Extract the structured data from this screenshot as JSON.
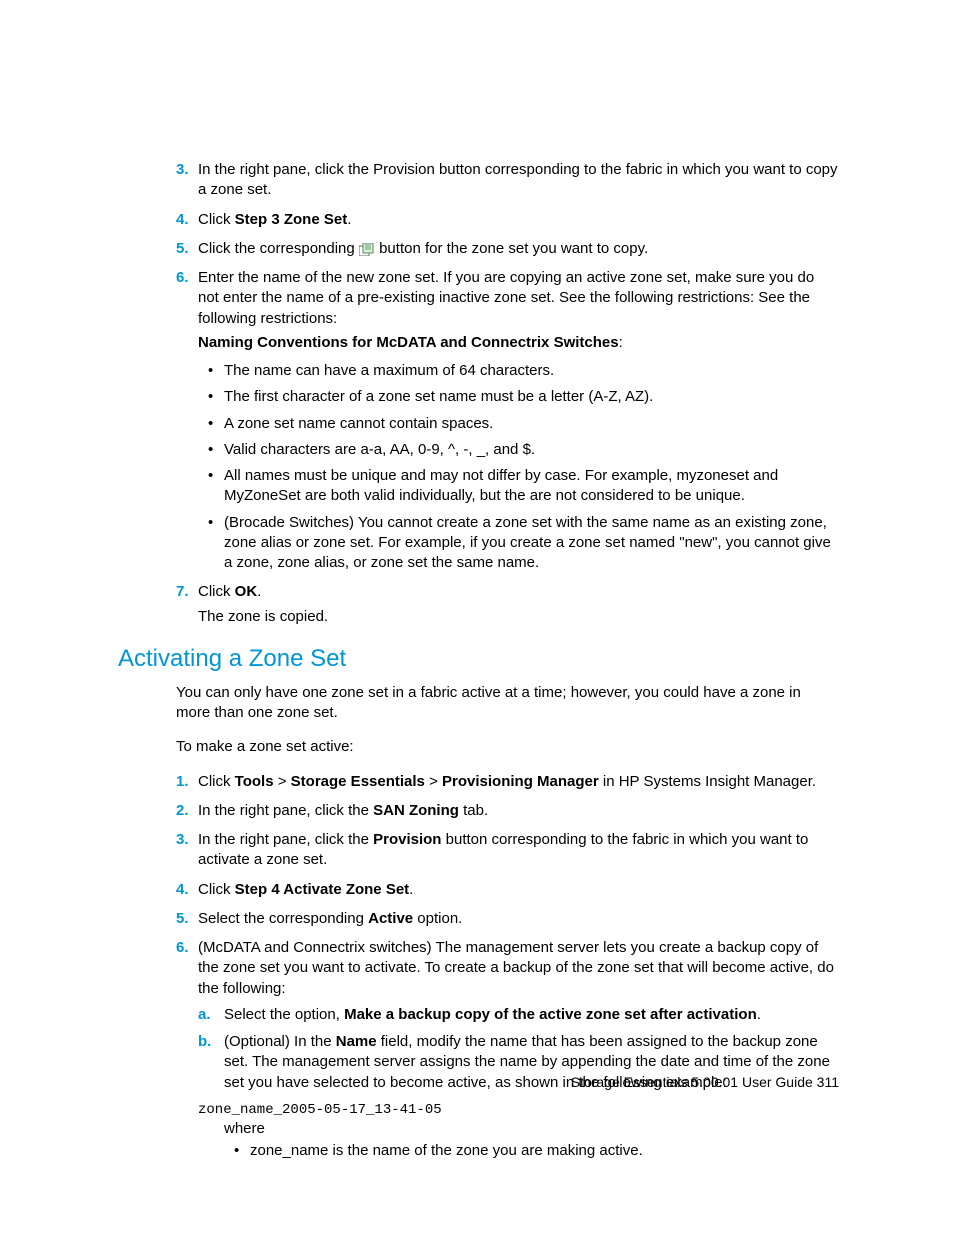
{
  "steps_top": [
    {
      "num": "3.",
      "text": "In the right pane, click the Provision button corresponding to the fabric in which you want to copy a zone set."
    },
    {
      "num": "4.",
      "prefix": "Click ",
      "bold": "Step 3 Zone Set",
      "suffix": "."
    },
    {
      "num": "5.",
      "prefix": "Click the corresponding ",
      "suffix": " button for the zone set you want to copy."
    },
    {
      "num": "6.",
      "text": "Enter the name of the new zone set. If you are copying an active zone set, make sure you do not enter the name of a pre-existing inactive zone set. See the following restrictions: See the following restrictions:"
    },
    {
      "num": "7.",
      "prefix": "Click ",
      "bold": "OK",
      "suffix": "."
    }
  ],
  "naming_header": "Naming Conventions for McDATA and Connectrix Switches",
  "naming_bullets": [
    "The name can have a maximum of 64 characters.",
    "The first character of a zone set name must be a letter (A-Z, AZ).",
    "A zone set name cannot contain spaces.",
    "Valid characters are a-a, AA, 0-9, ^, -, _, and $.",
    "All names must be unique and may not differ by case. For example, myzoneset and MyZoneSet are both valid individually, but the are not considered to be unique.",
    "(Brocade Switches) You cannot create a zone set with the same name as an existing zone, zone alias or zone set. For example, if you create a zone set named \"new\", you cannot give a zone, zone alias, or zone set the same name."
  ],
  "copied_note": "The zone is copied.",
  "section_heading": "Activating a Zone Set",
  "intro1": "You can only have one zone set in a fabric active at a time; however, you could have a zone in more than one zone set.",
  "intro2": "To make a zone set active:",
  "steps_bottom": {
    "s1": {
      "num": "1.",
      "prefix": "Click ",
      "b1": "Tools",
      "gt1": " > ",
      "b2": "Storage Essentials",
      "gt2": " > ",
      "b3": "Provisioning Manager",
      "suffix": " in HP Systems Insight Manager."
    },
    "s2": {
      "num": "2.",
      "prefix": "In the right pane, click the ",
      "bold": "SAN Zoning",
      "suffix": " tab."
    },
    "s3": {
      "num": "3.",
      "prefix": "In the right pane, click the ",
      "bold": "Provision",
      "suffix": " button corresponding to the fabric in which you want to activate a zone set."
    },
    "s4": {
      "num": "4.",
      "prefix": "Click ",
      "bold": "Step 4 Activate Zone Set",
      "suffix": "."
    },
    "s5": {
      "num": "5.",
      "prefix": "Select the corresponding ",
      "bold": "Active",
      "suffix": " option."
    },
    "s6": {
      "num": "6.",
      "text": "(McDATA and Connectrix switches) The management server lets you create a backup copy of the zone set you want to activate. To create a backup of the zone set that will become active, do the following:"
    }
  },
  "sub_steps": {
    "a": {
      "num": "a.",
      "prefix": "Select the option, ",
      "bold": "Make a backup copy of the active zone set after activation",
      "suffix": "."
    },
    "b": {
      "num": "b.",
      "prefix": "(Optional) In the ",
      "bold": "Name",
      "suffix": " field, modify the name that has been assigned to the backup zone set. The management server assigns the name by appending the date and time of the zone set you have selected to become active, as shown in the following example:"
    }
  },
  "code_line": "zone_name_2005-05-17_13-41-05",
  "where": "where",
  "where_bullet": "zone_name is the name of the zone you are making active.",
  "footer": "Storage Essentials 5.00.01 User Guide   311"
}
